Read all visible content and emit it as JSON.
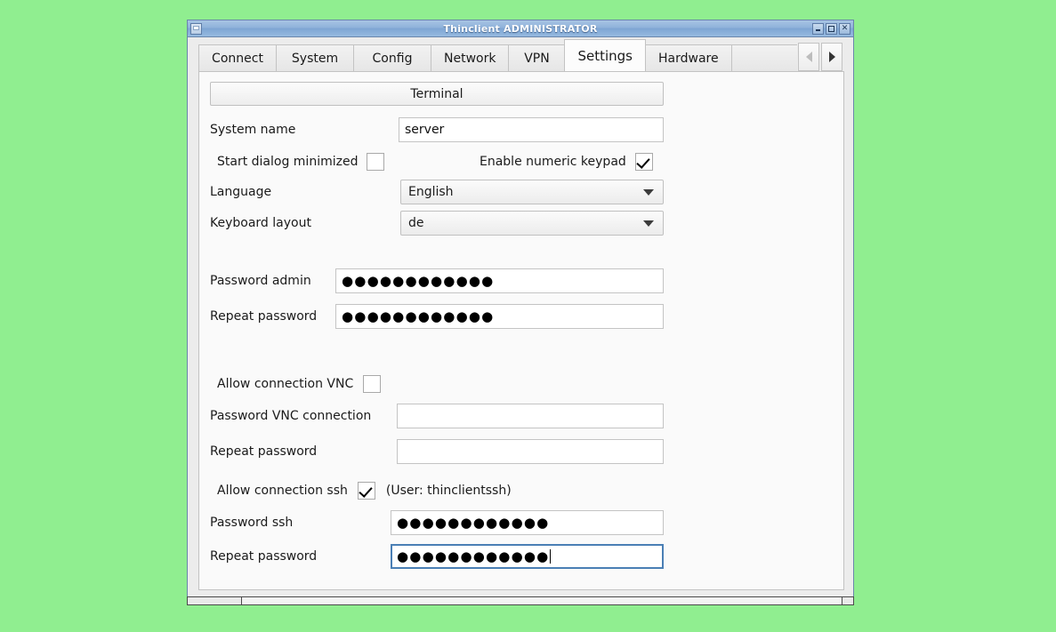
{
  "window": {
    "title": "Thinclient ADMINISTRATOR",
    "icon": "window-icon",
    "buttons": [
      {
        "name": "minimize",
        "label": "minimize-icon"
      },
      {
        "name": "maximize",
        "label": "maximize-icon"
      },
      {
        "name": "close",
        "label": "close-icon"
      }
    ]
  },
  "tabs": [
    {
      "label": "Connect",
      "active": false
    },
    {
      "label": "System",
      "active": false
    },
    {
      "label": "Config",
      "active": false
    },
    {
      "label": "Network",
      "active": false
    },
    {
      "label": "VPN",
      "active": false
    },
    {
      "label": "Settings",
      "active": true
    },
    {
      "label": "Hardware",
      "active": false
    }
  ],
  "tab_nav": {
    "prev_icon": "chevron-left-icon",
    "next_icon": "chevron-right-icon",
    "prev_enabled": false,
    "next_enabled": true
  },
  "settings": {
    "terminal_button": "Terminal",
    "system_name": {
      "label": "System name",
      "value": "server"
    },
    "start_minimized": {
      "label": "Start dialog minimized",
      "checked": false
    },
    "numeric_keypad": {
      "label": "Enable numeric keypad",
      "checked": true
    },
    "language": {
      "label": "Language",
      "value": "English"
    },
    "keyboard_layout": {
      "label": "Keyboard layout",
      "value": "de"
    },
    "password_admin": {
      "label": "Password admin",
      "value": "############"
    },
    "repeat_password_admin": {
      "label": "Repeat password",
      "value": "############"
    },
    "allow_vnc": {
      "label": "Allow connection VNC",
      "checked": false
    },
    "password_vnc": {
      "label": "Password VNC connection",
      "value": ""
    },
    "repeat_password_vnc": {
      "label": "Repeat password",
      "value": ""
    },
    "allow_ssh": {
      "label": "Allow connection ssh",
      "checked": true,
      "note": "(User: thinclientssh)"
    },
    "password_ssh": {
      "label": "Password ssh",
      "value": "############"
    },
    "repeat_password_ssh": {
      "label": "Repeat password",
      "value": "############",
      "focused": true
    }
  },
  "colors": {
    "desktop": "#90ee90",
    "titlebar_start": "#a7c4e4",
    "titlebar_end": "#96bae0",
    "focus_border": "#4a7fb5",
    "panel_bg": "#fafafa",
    "frame_bg": "#ececec"
  }
}
